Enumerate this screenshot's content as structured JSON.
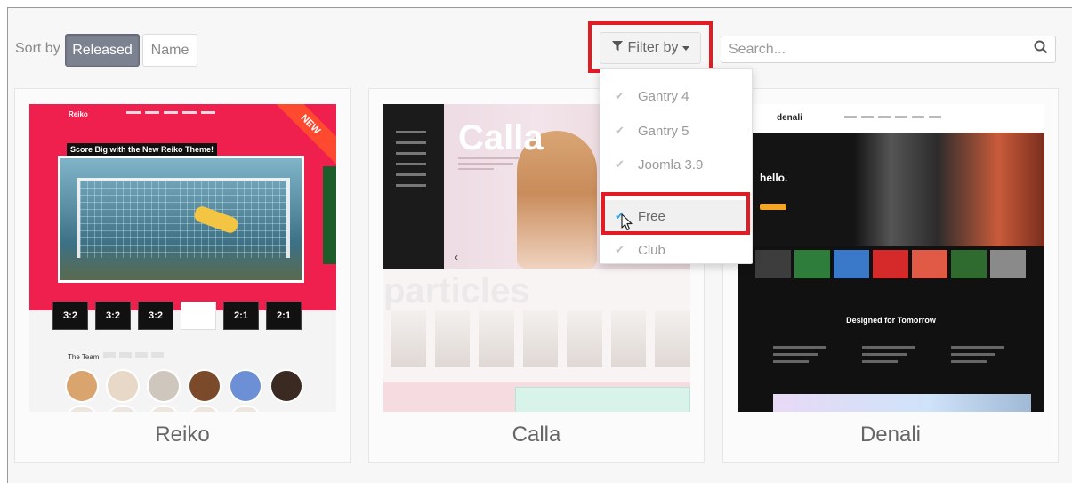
{
  "toolbar": {
    "sort_label": "Sort by",
    "sort_options": [
      "Released",
      "Name"
    ],
    "active_sort": "Released",
    "filter_label": "Filter by",
    "search_placeholder": "Search..."
  },
  "filter_menu": {
    "items": [
      {
        "label": "Gantry 4",
        "checked": false
      },
      {
        "label": "Gantry 5",
        "checked": false
      },
      {
        "label": "Joomla 3.9",
        "checked": false
      },
      {
        "label": "Free",
        "checked": true,
        "highlighted": true
      },
      {
        "label": "Club",
        "checked": false
      }
    ]
  },
  "highlight_color": "#e21c24",
  "check_color": "#3aa3e0",
  "themes": [
    {
      "name": "Reiko",
      "badge": "NEW",
      "preview": {
        "logo": "Reiko",
        "headline": "Score Big with the New Reiko Theme!",
        "counters": [
          "3:2",
          "3:2",
          "3:2",
          "",
          "2:1",
          "2:1"
        ],
        "team_label": "The Team"
      }
    },
    {
      "name": "Calla",
      "preview": {
        "hero_title": "Calla",
        "ghost_title": "particles"
      }
    },
    {
      "name": "Denali",
      "preview": {
        "logo": "denali",
        "hero_text": "hello.",
        "featured": "Designed for Tomorrow"
      }
    }
  ]
}
